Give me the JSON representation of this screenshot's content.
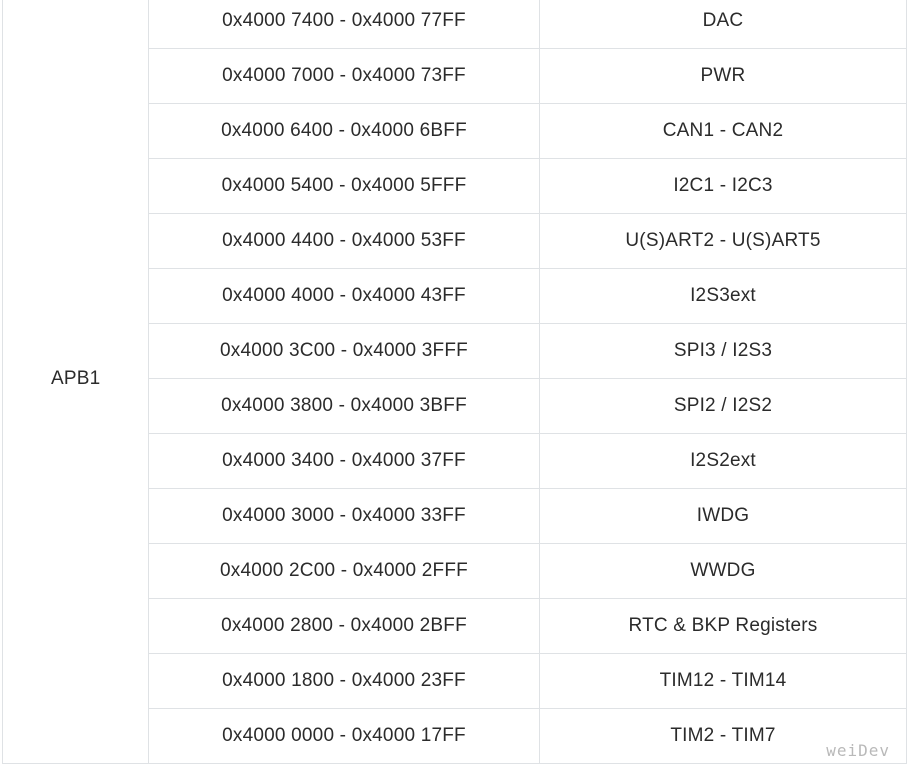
{
  "table": {
    "bus": "APB1",
    "rows": [
      {
        "range": "0x4000 7400 - 0x4000 77FF",
        "peripheral": "DAC"
      },
      {
        "range": "0x4000 7000 - 0x4000 73FF",
        "peripheral": "PWR"
      },
      {
        "range": "0x4000 6400 - 0x4000 6BFF",
        "peripheral": "CAN1 - CAN2"
      },
      {
        "range": "0x4000 5400 - 0x4000 5FFF",
        "peripheral": "I2C1 - I2C3"
      },
      {
        "range": "0x4000 4400 - 0x4000 53FF",
        "peripheral": "U(S)ART2 - U(S)ART5"
      },
      {
        "range": "0x4000 4000 - 0x4000 43FF",
        "peripheral": "I2S3ext"
      },
      {
        "range": "0x4000 3C00 - 0x4000 3FFF",
        "peripheral": "SPI3 / I2S3"
      },
      {
        "range": "0x4000 3800 - 0x4000 3BFF",
        "peripheral": "SPI2 / I2S2"
      },
      {
        "range": "0x4000 3400 - 0x4000 37FF",
        "peripheral": "I2S2ext"
      },
      {
        "range": "0x4000 3000 - 0x4000 33FF",
        "peripheral": "IWDG"
      },
      {
        "range": "0x4000 2C00 - 0x4000 2FFF",
        "peripheral": "WWDG"
      },
      {
        "range": "0x4000 2800 - 0x4000 2BFF",
        "peripheral": "RTC & BKP Registers"
      },
      {
        "range": "0x4000 1800 - 0x4000 23FF",
        "peripheral": "TIM12 - TIM14"
      },
      {
        "range": "0x4000 0000 - 0x4000 17FF",
        "peripheral": "TIM2 - TIM7"
      }
    ]
  },
  "watermark": "weiDev",
  "colors": {
    "border": "#dfe2e5",
    "text": "#2b2b2b",
    "watermark": "#b9b9b9"
  }
}
